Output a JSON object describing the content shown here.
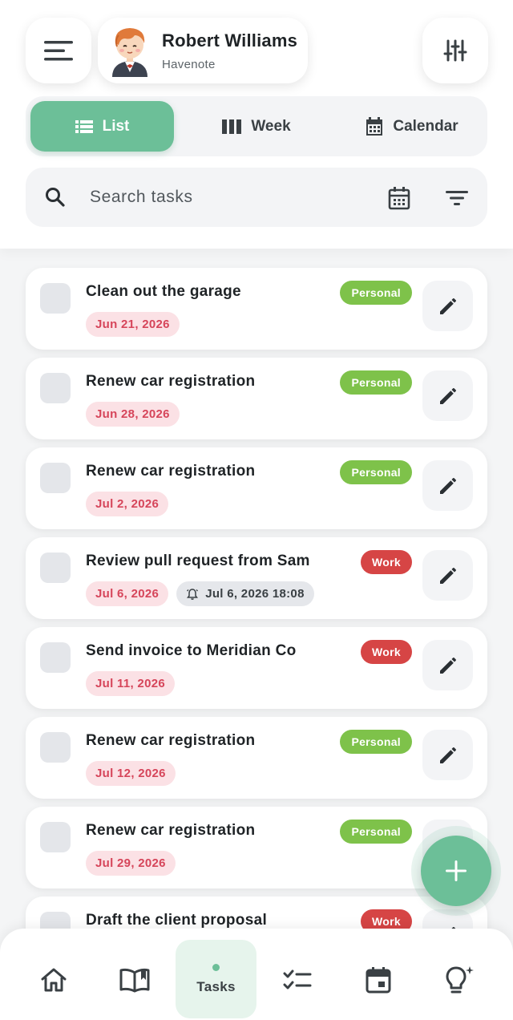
{
  "header": {
    "user_name": "Robert Williams",
    "app_name": "Havenote",
    "menu_icon": "hamburger-menu-icon",
    "settings_icon": "tune-sliders-icon"
  },
  "view_tabs": [
    {
      "label": "List",
      "icon": "list-icon",
      "active": true
    },
    {
      "label": "Week",
      "icon": "columns-icon",
      "active": false
    },
    {
      "label": "Calendar",
      "icon": "calendar-icon",
      "active": false
    }
  ],
  "search": {
    "placeholder": "Search tasks",
    "value": ""
  },
  "tasks": [
    {
      "title": "Clean out the garage",
      "date": "Jun 21, 2026",
      "tag": "Personal"
    },
    {
      "title": "Renew car registration",
      "date": "Jun 28, 2026",
      "tag": "Personal"
    },
    {
      "title": "Renew car registration",
      "date": "Jul 2, 2026",
      "tag": "Personal"
    },
    {
      "title": "Review pull request from Sam",
      "date": "Jul 6, 2026",
      "reminder": "Jul 6, 2026 18:08",
      "tag": "Work"
    },
    {
      "title": "Send invoice to Meridian Co",
      "date": "Jul 11, 2026",
      "tag": "Work"
    },
    {
      "title": "Renew car registration",
      "date": "Jul 12, 2026",
      "tag": "Personal"
    },
    {
      "title": "Renew car registration",
      "date": "Jul 29, 2026",
      "tag": "Personal"
    },
    {
      "title": "Draft the client proposal",
      "date": "",
      "tag": "Work"
    }
  ],
  "bottom_nav": [
    {
      "label": "",
      "icon": "home-icon"
    },
    {
      "label": "",
      "icon": "book-icon"
    },
    {
      "label": "Tasks",
      "icon": "dot-indicator",
      "active": true
    },
    {
      "label": "",
      "icon": "checklist-icon"
    },
    {
      "label": "",
      "icon": "calendar-day-icon"
    },
    {
      "label": "",
      "icon": "lightbulb-sparkle-icon"
    }
  ],
  "colors": {
    "accent": "#6cbf98",
    "personal_tag": "#7ec24a",
    "work_tag": "#d64545",
    "date_chip_bg": "#fbe1e5",
    "date_chip_text": "#d6455a"
  }
}
